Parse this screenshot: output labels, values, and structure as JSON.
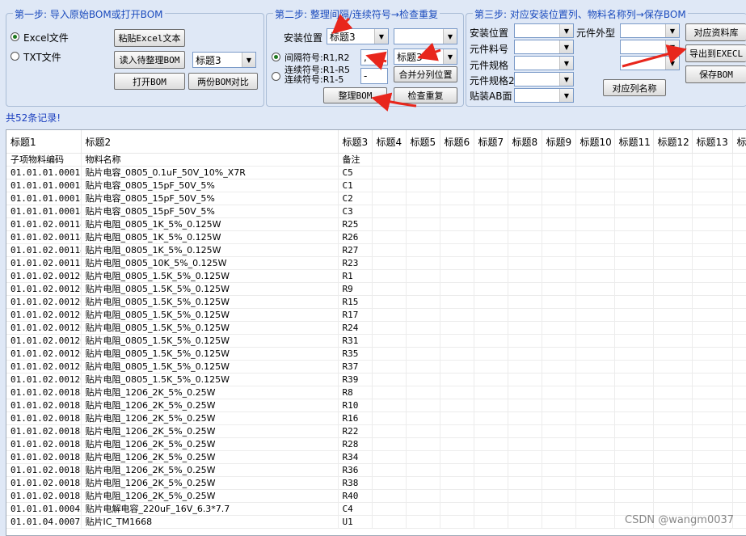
{
  "step1": {
    "legend": "第一步: 导入原始BOM或打开BOM",
    "radio_excel": "Excel文件",
    "radio_txt": "TXT文件",
    "paste_excel": "粘贴Excel文本",
    "read_bom": "读入待整理BOM",
    "title_select": "标题3",
    "open_bom": "打开BOM",
    "compare_bom": "两份BOM对比"
  },
  "step2": {
    "legend": "第二步: 整理间隔/连续符号→检查重复",
    "install_pos_label": "安装位置",
    "install_pos_select": "标题3",
    "install_pos_select2": "",
    "sep_radio_label": "间隔符号:R1,R2",
    "sep_value": ",",
    "sep_title_select": "标题3",
    "cont_radio_label1": "连续符号:R1-R5",
    "cont_radio_label2": "连续符号:R1-5",
    "cont_value": "-",
    "merge_btn": "合并分列位置",
    "organize_btn": "整理BOM",
    "check_dup_btn": "检查重复"
  },
  "step3": {
    "legend": "第三步: 对应安装位置列、物料名称列→保存BOM",
    "labels": [
      "安装位置",
      "元件料号",
      "元件规格",
      "元件规格2",
      "贴装AB面"
    ],
    "outline_label": "元件外型",
    "map_btn": "对应列名称",
    "lib_btn": "对应资料库",
    "export_btn": "导出到EXECL",
    "save_btn": "保存BOM"
  },
  "record_count": "共52条记录!",
  "table": {
    "headers": [
      "标题1",
      "标题2",
      "标题3",
      "标题4",
      "标题5",
      "标题6",
      "标题7",
      "标题8",
      "标题9",
      "标题10",
      "标题11",
      "标题12",
      "标题13",
      "标"
    ],
    "rows": [
      [
        "子项物料编码",
        "物料名称",
        "备注"
      ],
      [
        "01.01.01.00011",
        "贴片电容_0805_0.1uF_50V_10%_X7R",
        "C5"
      ],
      [
        "01.01.01.00018",
        "贴片电容_0805_15pF_50V_5%",
        "C1"
      ],
      [
        "01.01.01.00018",
        "贴片电容_0805_15pF_50V_5%",
        "C2"
      ],
      [
        "01.01.01.00018",
        "贴片电容_0805_15pF_50V_5%",
        "C3"
      ],
      [
        "01.01.02.00114",
        "贴片电阻_0805_1K_5%_0.125W",
        "R25"
      ],
      [
        "01.01.02.00114",
        "贴片电阻_0805_1K_5%_0.125W",
        "R26"
      ],
      [
        "01.01.02.00114",
        "贴片电阻_0805_1K_5%_0.125W",
        "R27"
      ],
      [
        "01.01.02.00115",
        "贴片电阻_0805_10K_5%_0.125W",
        "R23"
      ],
      [
        "01.01.02.00126",
        "贴片电阻_0805_1.5K_5%_0.125W",
        "R1"
      ],
      [
        "01.01.02.00126",
        "贴片电阻_0805_1.5K_5%_0.125W",
        "R9"
      ],
      [
        "01.01.02.00126",
        "贴片电阻_0805_1.5K_5%_0.125W",
        "R15"
      ],
      [
        "01.01.02.00126",
        "贴片电阻_0805_1.5K_5%_0.125W",
        "R17"
      ],
      [
        "01.01.02.00126",
        "贴片电阻_0805_1.5K_5%_0.125W",
        "R24"
      ],
      [
        "01.01.02.00126",
        "贴片电阻_0805_1.5K_5%_0.125W",
        "R31"
      ],
      [
        "01.01.02.00126",
        "贴片电阻_0805_1.5K_5%_0.125W",
        "R35"
      ],
      [
        "01.01.02.00126",
        "贴片电阻_0805_1.5K_5%_0.125W",
        "R37"
      ],
      [
        "01.01.02.00126",
        "贴片电阻_0805_1.5K_5%_0.125W",
        "R39"
      ],
      [
        "01.01.02.00188",
        "贴片电阻_1206_2K_5%_0.25W",
        "R8"
      ],
      [
        "01.01.02.00188",
        "贴片电阻_1206_2K_5%_0.25W",
        "R10"
      ],
      [
        "01.01.02.00188",
        "贴片电阻_1206_2K_5%_0.25W",
        "R16"
      ],
      [
        "01.01.02.00188",
        "贴片电阻_1206_2K_5%_0.25W",
        "R22"
      ],
      [
        "01.01.02.00188",
        "贴片电阻_1206_2K_5%_0.25W",
        "R28"
      ],
      [
        "01.01.02.00188",
        "贴片电阻_1206_2K_5%_0.25W",
        "R34"
      ],
      [
        "01.01.02.00188",
        "贴片电阻_1206_2K_5%_0.25W",
        "R36"
      ],
      [
        "01.01.02.00188",
        "贴片电阻_1206_2K_5%_0.25W",
        "R38"
      ],
      [
        "01.01.02.00188",
        "贴片电阻_1206_2K_5%_0.25W",
        "R40"
      ],
      [
        "01.01.01.00043",
        "贴片电解电容_220uF_16V_6.3*7.7",
        "C4"
      ],
      [
        "01.01.04.00072",
        "贴片IC_TM1668",
        "U1"
      ]
    ]
  },
  "watermark": "CSDN @wangm0037",
  "colors": {
    "legend": "#1b4bbd",
    "background": "#dfe8f6",
    "annotation_arrow": "#e8261c"
  }
}
